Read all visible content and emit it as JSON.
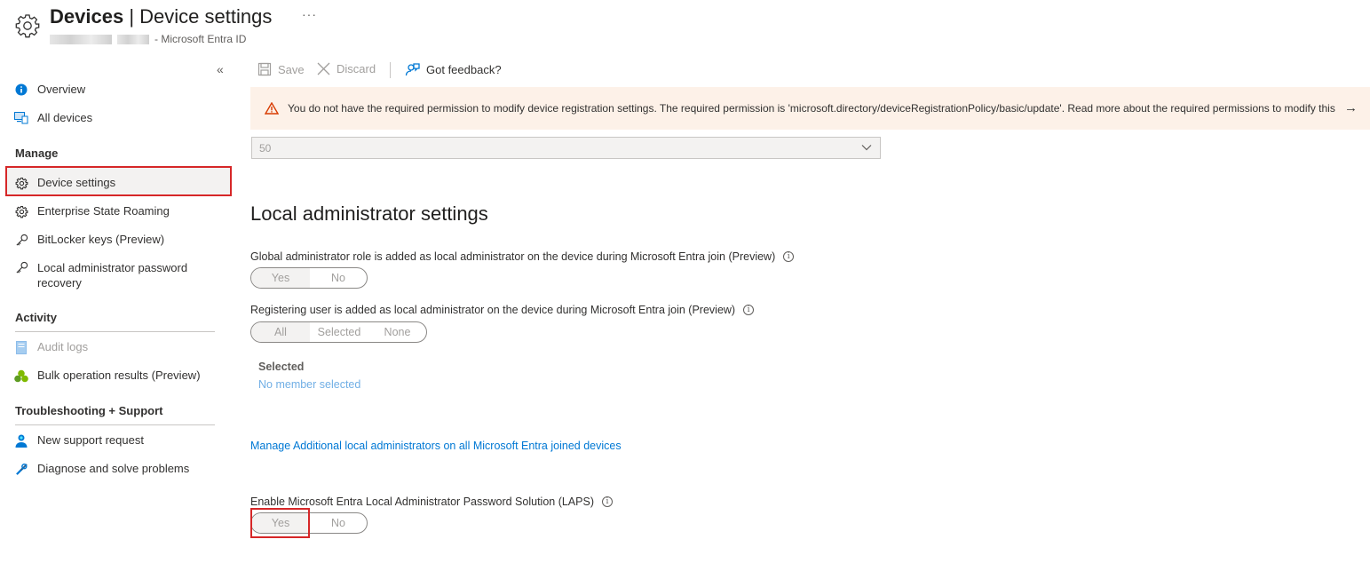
{
  "header": {
    "title": "Devices",
    "separator": "|",
    "subtitle": "Device settings",
    "more": "···",
    "breadcrumb_suffix": "- Microsoft Entra ID"
  },
  "sidebar": {
    "collapse": "«",
    "items_top": [
      {
        "label": "Overview",
        "icon": "info-icon"
      },
      {
        "label": "All devices",
        "icon": "devices-icon"
      }
    ],
    "manage_header": "Manage",
    "manage_items": [
      {
        "label": "Device settings",
        "icon": "gear-icon",
        "selected": true
      },
      {
        "label": "Enterprise State Roaming",
        "icon": "gear-icon"
      },
      {
        "label": "BitLocker keys (Preview)",
        "icon": "key-icon"
      },
      {
        "label": "Local administrator password recovery",
        "icon": "key-icon"
      }
    ],
    "activity_header": "Activity",
    "activity_items": [
      {
        "label": "Audit logs",
        "icon": "log-icon",
        "disabled": true
      },
      {
        "label": "Bulk operation results (Preview)",
        "icon": "clover-icon"
      }
    ],
    "support_header": "Troubleshooting + Support",
    "support_items": [
      {
        "label": "New support request",
        "icon": "person-icon"
      },
      {
        "label": "Diagnose and solve problems",
        "icon": "wrench-icon"
      }
    ]
  },
  "toolbar": {
    "save": "Save",
    "discard": "Discard",
    "feedback": "Got feedback?"
  },
  "banner": {
    "message": "You do not have the required permission to modify device registration settings. The required permission is 'microsoft.directory/deviceRegistrationPolicy/basic/update'. Read more about the required permissions to modify this",
    "arrow": "→"
  },
  "dropdown": {
    "value": "50"
  },
  "section": {
    "title": "Local administrator settings",
    "global_admin_label": "Global administrator role is added as local administrator on the device during Microsoft Entra join (Preview)",
    "global_admin_toggle": {
      "yes": "Yes",
      "no": "No",
      "selected": "Yes"
    },
    "registering_user_label": "Registering user is added as local administrator on the device during Microsoft Entra join (Preview)",
    "registering_user_toggle": {
      "all": "All",
      "selected_opt": "Selected",
      "none": "None",
      "selected": "All"
    },
    "selected_label": "Selected",
    "selected_value": "No member selected",
    "manage_link": "Manage Additional local administrators on all Microsoft Entra joined devices",
    "laps_label": "Enable Microsoft Entra Local Administrator Password Solution (LAPS)",
    "laps_toggle": {
      "yes": "Yes",
      "no": "No",
      "selected": "Yes"
    }
  },
  "colors": {
    "accent": "#0078d4",
    "highlight": "#d62728",
    "warning_bg": "#fdf1e8",
    "warning_icon": "#d83b01"
  }
}
